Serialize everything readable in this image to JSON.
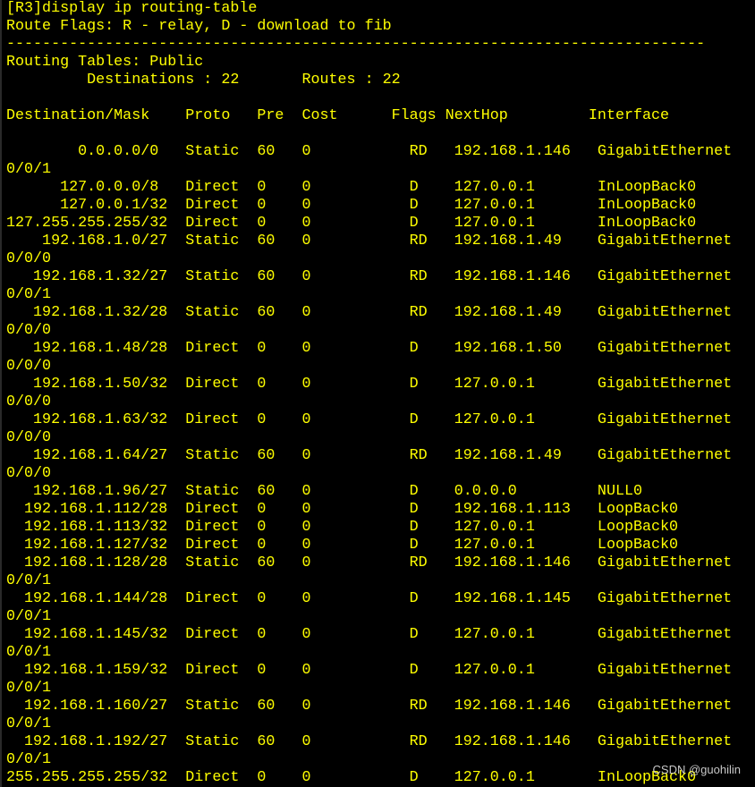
{
  "terminal": {
    "text_color": "#ffff00",
    "background": "#000000",
    "lines": [
      "[R3]display ip routing-table",
      "Route Flags: R - relay, D - download to fib",
      "------------------------------------------------------------------------------",
      "Routing Tables: Public",
      "         Destinations : 22       Routes : 22",
      "",
      "Destination/Mask    Proto   Pre  Cost      Flags NextHop         Interface",
      "",
      "        0.0.0.0/0   Static  60   0           RD   192.168.1.146   GigabitEthernet",
      "0/0/1",
      "      127.0.0.0/8   Direct  0    0           D    127.0.0.1       InLoopBack0",
      "      127.0.0.1/32  Direct  0    0           D    127.0.0.1       InLoopBack0",
      "127.255.255.255/32  Direct  0    0           D    127.0.0.1       InLoopBack0",
      "    192.168.1.0/27  Static  60   0           RD   192.168.1.49    GigabitEthernet",
      "0/0/0",
      "   192.168.1.32/27  Static  60   0           RD   192.168.1.146   GigabitEthernet",
      "0/0/1",
      "   192.168.1.32/28  Static  60   0           RD   192.168.1.49    GigabitEthernet",
      "0/0/0",
      "   192.168.1.48/28  Direct  0    0           D    192.168.1.50    GigabitEthernet",
      "0/0/0",
      "   192.168.1.50/32  Direct  0    0           D    127.0.0.1       GigabitEthernet",
      "0/0/0",
      "   192.168.1.63/32  Direct  0    0           D    127.0.0.1       GigabitEthernet",
      "0/0/0",
      "   192.168.1.64/27  Static  60   0           RD   192.168.1.49    GigabitEthernet",
      "0/0/0",
      "   192.168.1.96/27  Static  60   0           D    0.0.0.0         NULL0",
      "  192.168.1.112/28  Direct  0    0           D    192.168.1.113   LoopBack0",
      "  192.168.1.113/32  Direct  0    0           D    127.0.0.1       LoopBack0",
      "  192.168.1.127/32  Direct  0    0           D    127.0.0.1       LoopBack0",
      "  192.168.1.128/28  Static  60   0           RD   192.168.1.146   GigabitEthernet",
      "0/0/1",
      "  192.168.1.144/28  Direct  0    0           D    192.168.1.145   GigabitEthernet",
      "0/0/1",
      "  192.168.1.145/32  Direct  0    0           D    127.0.0.1       GigabitEthernet",
      "0/0/1",
      "  192.168.1.159/32  Direct  0    0           D    127.0.0.1       GigabitEthernet",
      "0/0/1",
      "  192.168.1.160/27  Static  60   0           RD   192.168.1.146   GigabitEthernet",
      "0/0/1",
      "  192.168.1.192/27  Static  60   0           RD   192.168.1.146   GigabitEthernet",
      "0/0/1",
      "255.255.255.255/32  Direct  0    0           D    127.0.0.1       InLoopBack0"
    ]
  },
  "watermark": "CSDN @guohilin"
}
